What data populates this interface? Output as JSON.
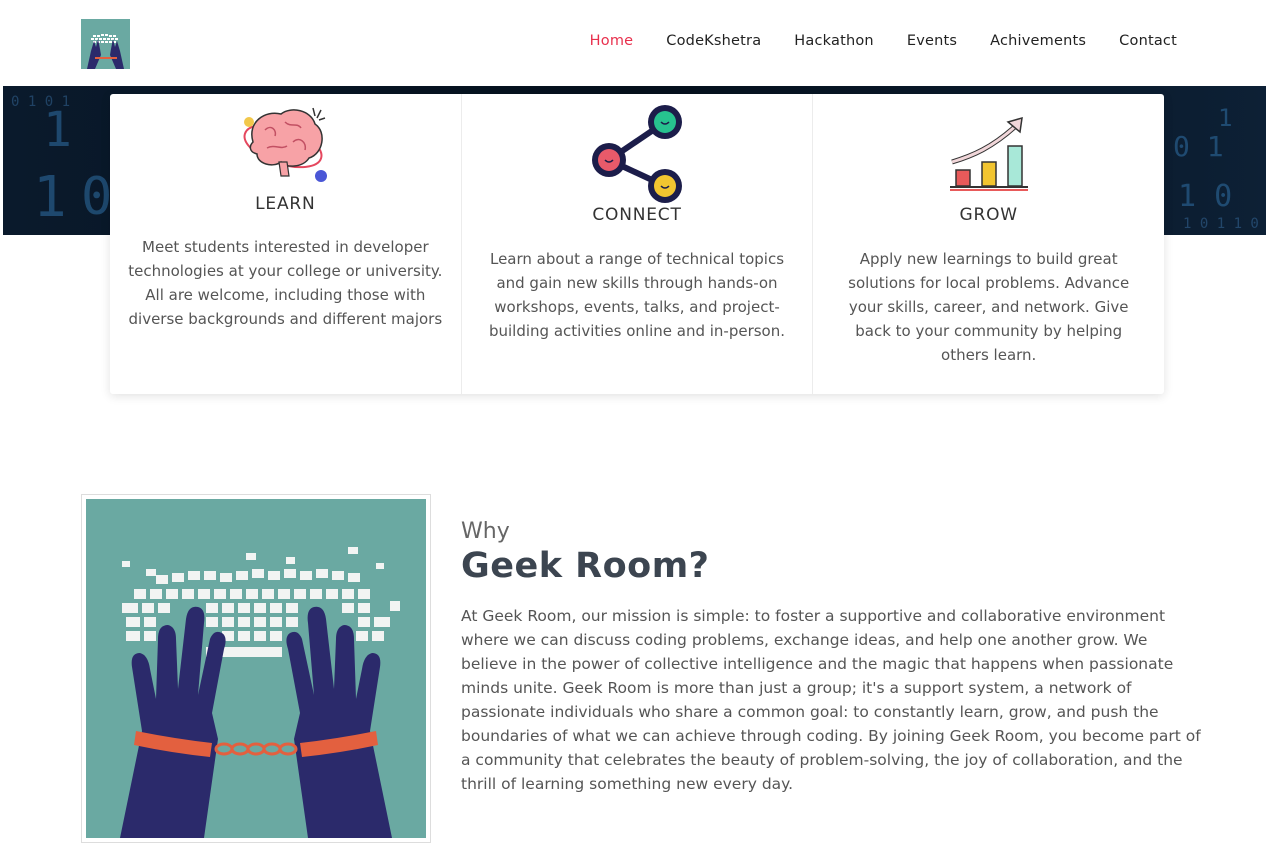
{
  "nav": {
    "items": [
      {
        "label": "Home",
        "active": true
      },
      {
        "label": "CodeKshetra",
        "active": false
      },
      {
        "label": "Hackathon",
        "active": false
      },
      {
        "label": "Events",
        "active": false
      },
      {
        "label": "Achivements",
        "active": false
      },
      {
        "label": "Contact",
        "active": false
      }
    ]
  },
  "cards": [
    {
      "title": "LEARN",
      "icon": "brain-icon",
      "text": "Meet students interested in developer technologies at your college or university. All are welcome, including those with diverse backgrounds and different majors"
    },
    {
      "title": "CONNECT",
      "icon": "network-icon",
      "text": "Learn about a range of technical topics and gain new skills through hands-on workshops, events, talks, and project-building activities online and in-person."
    },
    {
      "title": "GROW",
      "icon": "growth-chart-icon",
      "text": "Apply new learnings to build great solutions for local problems. Advance your skills, career, and network. Give back to your community by helping others learn."
    }
  ],
  "why": {
    "subtitle": "Why",
    "title": "Geek Room?",
    "body": "At Geek Room, our mission is simple: to foster a supportive and collaborative environment where we can discuss coding problems, exchange ideas, and help one another grow. We believe in the power of collective intelligence and the magic that happens when passionate minds unite. Geek Room is more than just a group; it's a support system, a network of passionate individuals who share a common goal: to constantly learn, grow, and push the boundaries of what we can achieve through coding. By joining Geek Room, you become part of a community that celebrates the beauty of problem-solving, the joy of collaboration, and the thrill of learning something new every day."
  },
  "colors": {
    "accent": "#e8304d",
    "teal": "#6aa9a2",
    "navy": "#2b2a6b",
    "cuff": "#e3603f"
  }
}
